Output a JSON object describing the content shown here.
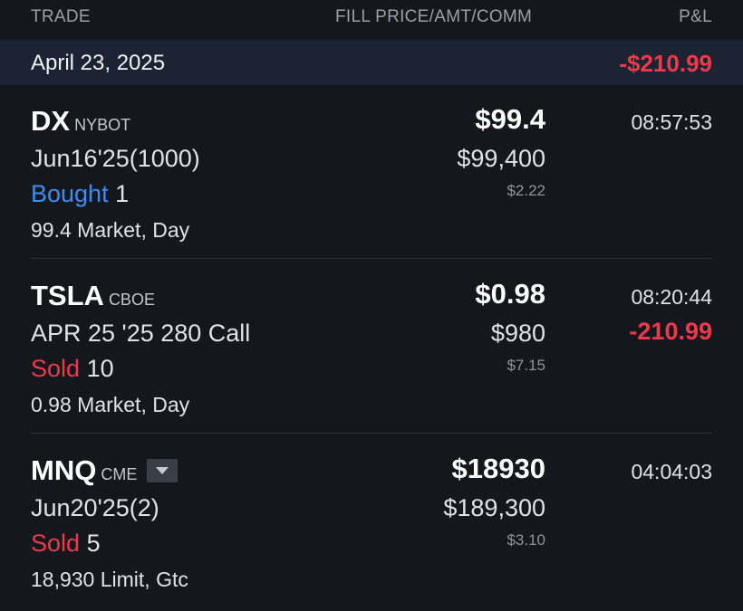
{
  "header": {
    "trade_label": "TRADE",
    "fill_label": "FILL PRICE/AMT/COMM",
    "pl_label": "P&L"
  },
  "date_group": {
    "date": "April 23, 2025",
    "pl": "-$210.99"
  },
  "colors": {
    "background": "#14171c",
    "date_bar": "#1c2433",
    "negative": "#f0384c",
    "bought": "#3d8df5"
  },
  "trades": [
    {
      "symbol": "DX",
      "exchange": "NYBOT",
      "contract": "Jun16'25(1000)",
      "action": "Bought",
      "quantity": "1",
      "order_desc": "99.4 Market, Day",
      "fill_price": "$99.4",
      "amount": "$99,400",
      "commission": "$2.22",
      "time": "08:57:53",
      "pl": ""
    },
    {
      "symbol": "TSLA",
      "exchange": "CBOE",
      "contract": "APR 25 '25 280 Call",
      "action": "Sold",
      "quantity": "10",
      "order_desc": "0.98 Market, Day",
      "fill_price": "$0.98",
      "amount": "$980",
      "commission": "$7.15",
      "time": "08:20:44",
      "pl": "-210.99"
    },
    {
      "symbol": "MNQ",
      "exchange": "CME",
      "contract": "Jun20'25(2)",
      "action": "Sold",
      "quantity": "5",
      "order_desc": "18,930 Limit, Gtc",
      "fill_price": "$18930",
      "amount": "$189,300",
      "commission": "$3.10",
      "time": "04:04:03",
      "pl": "",
      "dropdown_icon": "chevron-down-icon"
    }
  ]
}
